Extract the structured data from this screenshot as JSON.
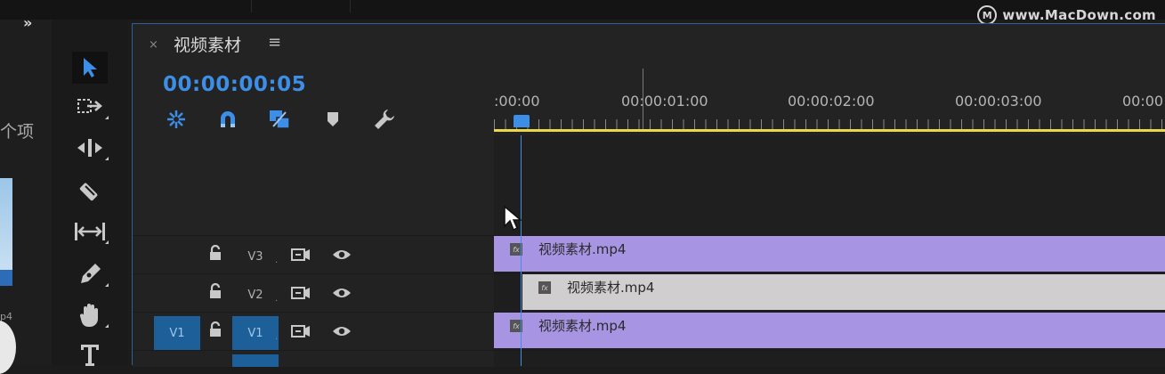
{
  "watermark": {
    "logo": "M",
    "text": "www.MacDown.com"
  },
  "left_panel": {
    "collapse_glyph": "»",
    "items_text": "个项",
    "thumb_label": "p4"
  },
  "timeline": {
    "tab_close": "×",
    "tab_title": "视频素材",
    "tab_menu": "≡",
    "timecode": "00:00:00:05",
    "ruler_labels": [
      ":00:00",
      "00:00:01:00",
      "00:00:02:00",
      "00:00:03:00",
      "00:00"
    ],
    "tracks": [
      {
        "name": "V3",
        "source": "",
        "target_on": false,
        "clip": {
          "label": "视频素材.mp4",
          "color": "purple"
        }
      },
      {
        "name": "V2",
        "source": "",
        "target_on": false,
        "clip": {
          "label": "视频素材.mp4",
          "color": "gray"
        }
      },
      {
        "name": "V1",
        "source": "V1",
        "target_on": true,
        "clip": {
          "label": "视频素材.mp4",
          "color": "purple"
        }
      }
    ],
    "fx_badge": "fx"
  },
  "colors": {
    "accent_blue": "#3d8ee6",
    "track_button_blue": "#1d5f98",
    "clip_purple": "#a795e3",
    "clip_gray": "#d0cece",
    "work_area_yellow": "#e8d84a"
  },
  "icons": {
    "tools": [
      "selection-tool-icon",
      "track-select-forward-icon",
      "ripple-edit-icon",
      "razor-icon",
      "slip-icon",
      "pen-icon",
      "hand-icon",
      "type-icon"
    ],
    "timeline_header": [
      "nest-sequence-icon",
      "snap-icon",
      "linked-selection-icon",
      "add-marker-icon",
      "timeline-settings-wrench-icon"
    ]
  }
}
